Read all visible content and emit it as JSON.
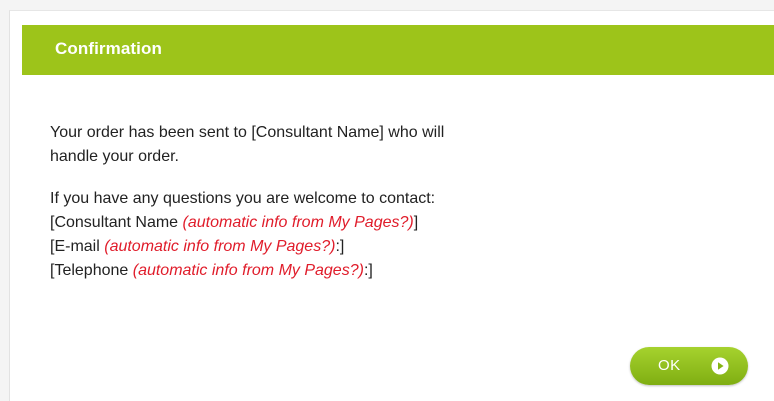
{
  "dialog": {
    "title": "Confirmation",
    "paragraph1": {
      "line1": "Your order has been sent to [Consultant Name] who will",
      "line2": "handle your order."
    },
    "paragraph2": {
      "intro": "If you have any questions you are welcome to contact:",
      "consultant_prefix": "[Consultant Name ",
      "consultant_note": "(automatic info from My Pages?)",
      "consultant_suffix": "]",
      "email_prefix": "[E-mail ",
      "email_note": "(automatic info from My Pages?)",
      "email_suffix": ":]",
      "phone_prefix": "[Telephone ",
      "phone_note": "(automatic info from My Pages?)",
      "phone_suffix": ":]"
    },
    "ok_button": {
      "label": "OK",
      "icon": "play-circle-icon"
    }
  },
  "colors": {
    "header_background": "#9dc41a",
    "note_text": "#e01c2a",
    "button_green": "#8dbc1c"
  }
}
